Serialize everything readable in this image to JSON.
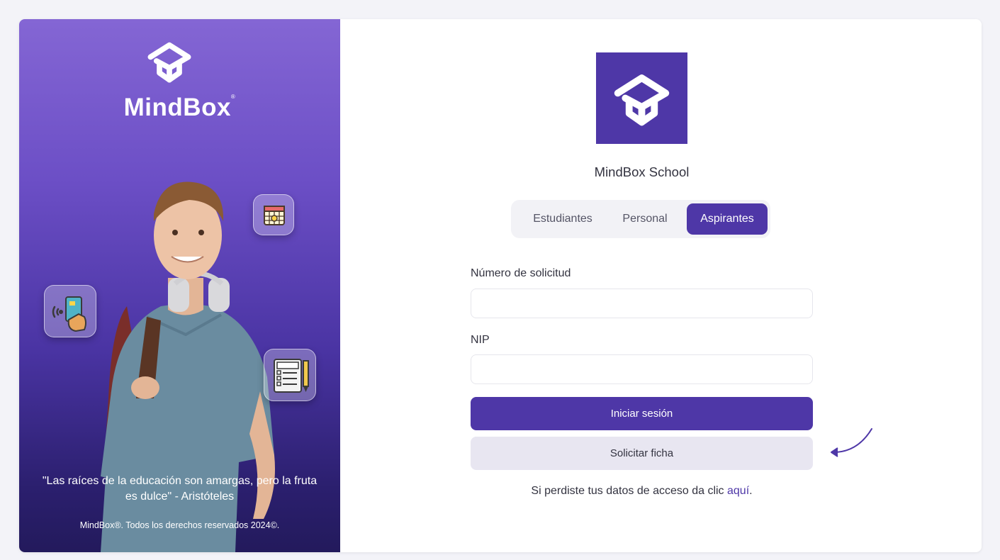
{
  "brand": {
    "name": "MindBox",
    "trademark": "®",
    "quote": "\"Las raíces de la educación son amargas, pero la fruta es dulce\" - Aristóteles",
    "copyright": "MindBox®. Todos los derechos reservados 2024©."
  },
  "floating_icons": [
    "calendar-icon",
    "contactless-card-icon",
    "exam-icon"
  ],
  "login": {
    "school_name": "MindBox School",
    "tabs": [
      {
        "label": "Estudiantes",
        "active": false
      },
      {
        "label": "Personal",
        "active": false
      },
      {
        "label": "Aspirantes",
        "active": true
      }
    ],
    "fields": {
      "request_number_label": "Número de solicitud",
      "request_number_value": "",
      "nip_label": "NIP",
      "nip_value": ""
    },
    "login_button": "Iniciar sesión",
    "request_button": "Solicitar ficha",
    "help_text": "Si perdiste tus datos de acceso da clic ",
    "help_link": "aquí",
    "help_suffix": "."
  },
  "colors": {
    "accent": "#4e37a7",
    "panel_top": "#8466d4",
    "panel_bottom": "#231a5c",
    "secondary_button": "#e8e6f1"
  }
}
